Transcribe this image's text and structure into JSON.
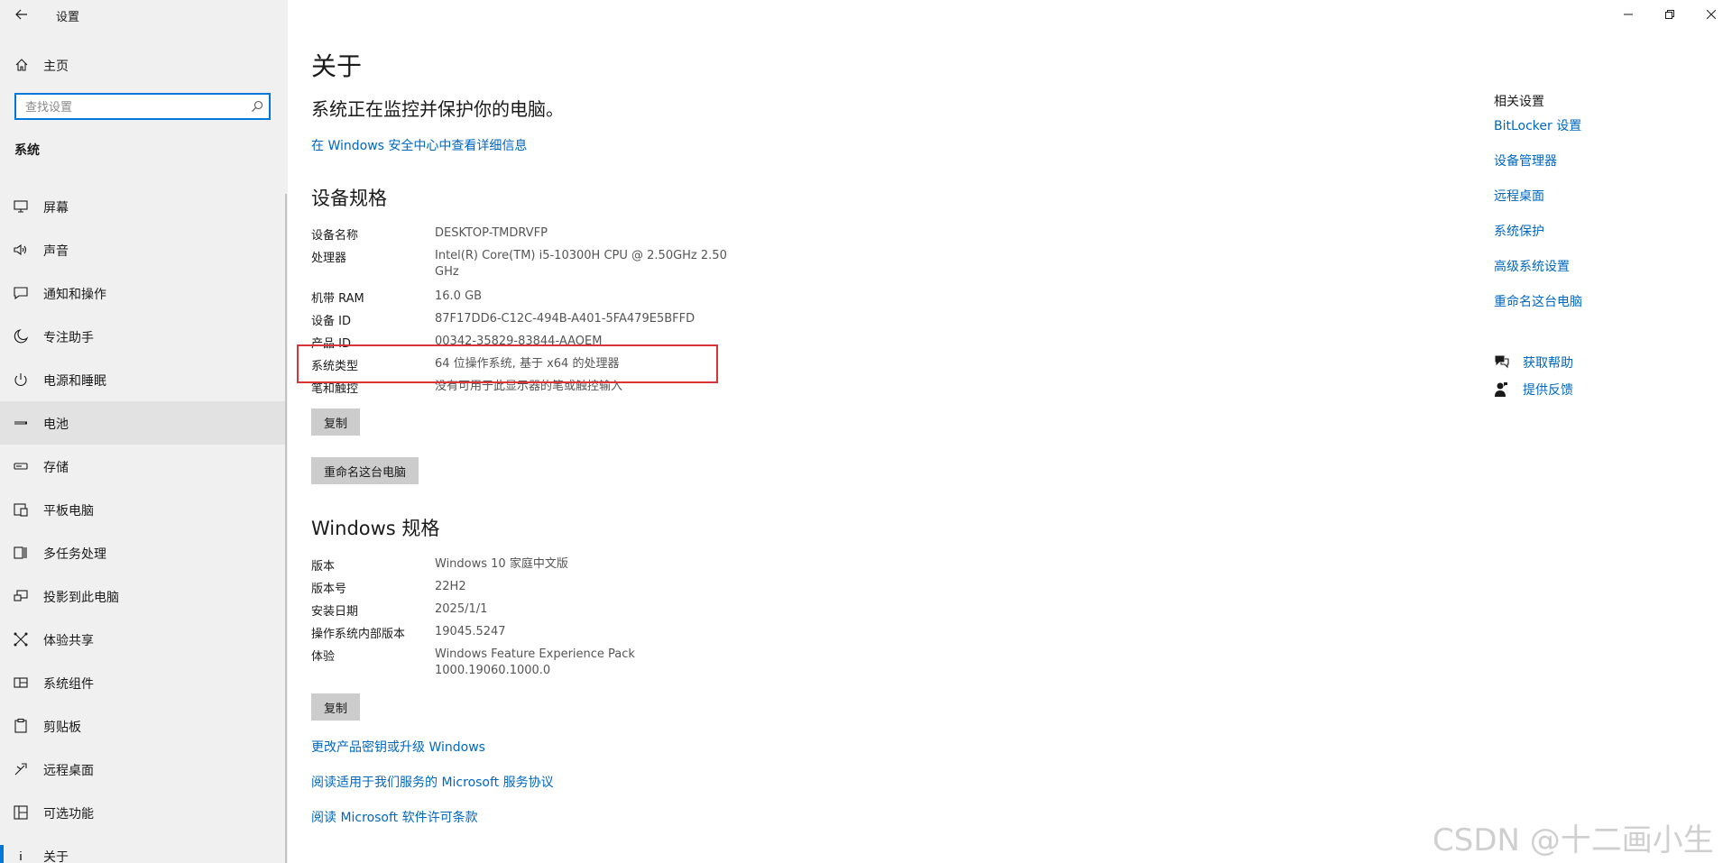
{
  "window": {
    "title": "设置"
  },
  "sidebar": {
    "home_label": "主页",
    "search_placeholder": "查找设置",
    "section_label": "系统",
    "items": [
      {
        "label": "屏幕",
        "icon": "monitor-icon"
      },
      {
        "label": "声音",
        "icon": "speaker-icon"
      },
      {
        "label": "通知和操作",
        "icon": "notification-icon"
      },
      {
        "label": "专注助手",
        "icon": "moon-icon"
      },
      {
        "label": "电源和睡眠",
        "icon": "power-icon"
      },
      {
        "label": "电池",
        "icon": "battery-icon"
      },
      {
        "label": "存储",
        "icon": "storage-icon"
      },
      {
        "label": "平板电脑",
        "icon": "tablet-icon"
      },
      {
        "label": "多任务处理",
        "icon": "multitask-icon"
      },
      {
        "label": "投影到此电脑",
        "icon": "project-icon"
      },
      {
        "label": "体验共享",
        "icon": "share-icon"
      },
      {
        "label": "系统组件",
        "icon": "components-icon"
      },
      {
        "label": "剪贴板",
        "icon": "clipboard-icon"
      },
      {
        "label": "远程桌面",
        "icon": "remote-desktop-icon"
      },
      {
        "label": "可选功能",
        "icon": "optional-features-icon"
      },
      {
        "label": "关于",
        "icon": "info-icon"
      }
    ],
    "active_index": 15,
    "hover_index": 5
  },
  "main": {
    "title": "关于",
    "status": "系统正在监控并保护你的电脑。",
    "security_link": "在 Windows 安全中心中查看详细信息",
    "device_specs": {
      "heading": "设备规格",
      "rows": [
        {
          "key": "设备名称",
          "value": "DESKTOP-TMDRVFP"
        },
        {
          "key": "处理器",
          "value": "Intel(R) Core(TM) i5-10300H CPU @ 2.50GHz   2.50 GHz"
        },
        {
          "key": "机带 RAM",
          "value": "16.0 GB"
        },
        {
          "key": "设备 ID",
          "value": "87F17DD6-C12C-494B-A401-5FA479E5BFFD"
        },
        {
          "key": "产品 ID",
          "value": "00342-35829-83844-AAOEM"
        },
        {
          "key": "系统类型",
          "value": "64 位操作系统, 基于 x64 的处理器"
        },
        {
          "key": "笔和触控",
          "value": "没有可用于此显示器的笔或触控输入"
        }
      ],
      "copy_label": "复制",
      "rename_label": "重命名这台电脑"
    },
    "windows_specs": {
      "heading": "Windows 规格",
      "rows": [
        {
          "key": "版本",
          "value": "Windows 10 家庭中文版"
        },
        {
          "key": "版本号",
          "value": "22H2"
        },
        {
          "key": "安装日期",
          "value": "2025/1/1"
        },
        {
          "key": "操作系统内部版本",
          "value": "19045.5247"
        },
        {
          "key": "体验",
          "value": "Windows Feature Experience Pack 1000.19060.1000.0"
        }
      ],
      "copy_label": "复制"
    },
    "links": [
      "更改产品密钥或升级 Windows",
      "阅读适用于我们服务的 Microsoft 服务协议",
      "阅读 Microsoft 软件许可条款"
    ]
  },
  "related": {
    "heading": "相关设置",
    "links": [
      "BitLocker 设置",
      "设备管理器",
      "远程桌面",
      "系统保护",
      "高级系统设置",
      "重命名这台电脑"
    ],
    "help": [
      {
        "label": "获取帮助",
        "icon": "help-chat-icon"
      },
      {
        "label": "提供反馈",
        "icon": "feedback-icon"
      }
    ]
  },
  "watermark": "CSDN @十二画小生",
  "colors": {
    "accent": "#0078d7",
    "link": "#0067c0",
    "highlight_border": "#d9343a",
    "sidebar_bg": "#f0f0f0"
  }
}
